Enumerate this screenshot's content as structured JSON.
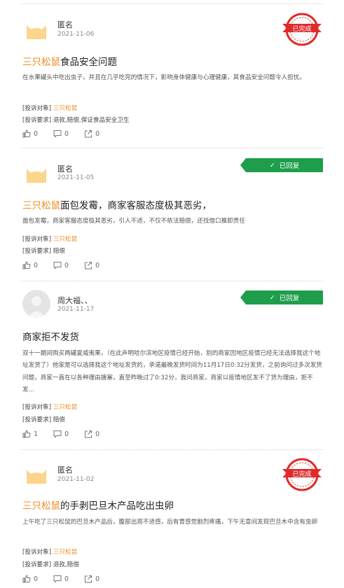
{
  "complaints": [
    {
      "user": "匿名",
      "date": "2021-11-06",
      "status": "已完成",
      "title_brand": "三只松鼠",
      "title_text": "食品安全问题",
      "content": "在水果罐头中吃出虫子，并且在几乎吃完的情况下，影响身体健康与心理健康，其食品安全问题令人担忧。",
      "target_label": "[投诉对象]",
      "target_value": "三只松鼠",
      "req_label": "[投诉要求]",
      "req_value": "退款,赔偿,保证食品安全卫生",
      "likes": "0",
      "comments": "0",
      "shares": "0"
    },
    {
      "user": "匿名",
      "date": "2021-11-05",
      "status": "已回复",
      "title_brand": "三只松鼠",
      "title_text": "面包发霉，商家客服态度极其恶劣，",
      "content": "面包发霉，商家客服态度极其恶劣，引人不适，不仅不依法赔偿，还找借口推卸责任",
      "target_label": "[投诉对象]",
      "target_value": "三只松鼠",
      "req_label": "[投诉要求]",
      "req_value": "赔偿",
      "likes": "0",
      "comments": "0",
      "shares": "0"
    },
    {
      "user": "周大福、、",
      "date": "2021-11-17",
      "status": "已回复",
      "title_brand": "",
      "title_text": "商家拒不发货",
      "content": "双十一期间购买两罐夏威夷果，（在此声明哈尔滨地区疫情已经开始，别的商家因地区疫情已经无法选择我这个地址发货了）他家是可以选择我这个地址发货的，承诺最晚发货时间为11月17日0:32分发货，之前询问过多次发货问题，商家一直在以各种理由搪塞，直至昨晚过了0:32分，我问商家，商家以疫情地区发不了货为理由，拒不发...",
      "target_label": "[投诉对象]",
      "target_value": "三只松鼠",
      "req_label": "[投诉要求]",
      "req_value": "赔偿",
      "likes": "1",
      "comments": "0",
      "shares": "0"
    },
    {
      "user": "匿名",
      "date": "2021-11-02",
      "status": "已完成",
      "title_brand": "三只松鼠",
      "title_text": "的手剥巴旦木产品吃出虫卵",
      "content": "上午吃了三只松鼠的巴旦木产品后，腹部出现不适感，后有胃感觉剧烈疼痛，下午无意间发现巴旦木中含有虫卵",
      "target_label": "[投诉对象]",
      "target_value": "三只松鼠",
      "req_label": "[投诉要求]",
      "req_value": "退款,赔偿",
      "likes": "0",
      "comments": "0",
      "shares": "0"
    }
  ],
  "icons": {
    "like": "thumbs-up-icon",
    "comment": "comment-icon",
    "share": "share-icon",
    "avatar_anon": "cat-avatar-icon",
    "avatar_default": "default-user-icon",
    "check": "check-icon",
    "stamp": "completed-stamp-icon"
  },
  "colors": {
    "brand": "#f08a1e",
    "replied": "#1e9e4a",
    "stamp": "#e02b2b"
  }
}
